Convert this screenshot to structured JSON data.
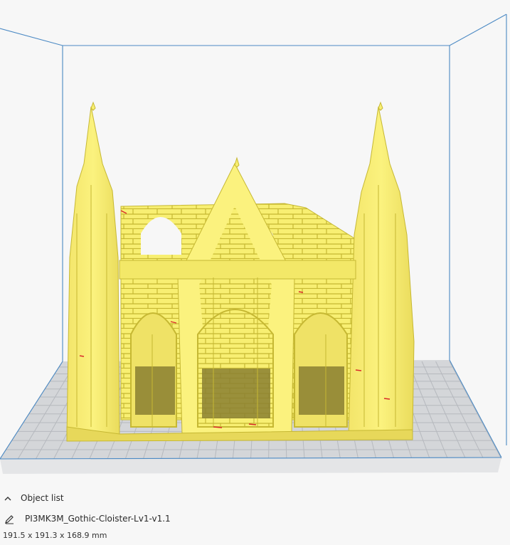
{
  "viewport": {
    "build_volume_color": "#4c8ac4",
    "plate_color": "#d4d6d9",
    "grid_color": "#b6b9be",
    "model_color": "#f8ef72",
    "model_shade": "#c6b833",
    "overhang_color": "#d9292a"
  },
  "object_list": {
    "toggle_label": "Object list",
    "toggle_icon": "chevron-up-icon",
    "edit_icon": "pencil-icon",
    "object_name": "PI3MK3M_Gothic-Cloister-Lv1-v1.1",
    "dimensions": "191.5 x 191.3 x 168.9 mm"
  }
}
